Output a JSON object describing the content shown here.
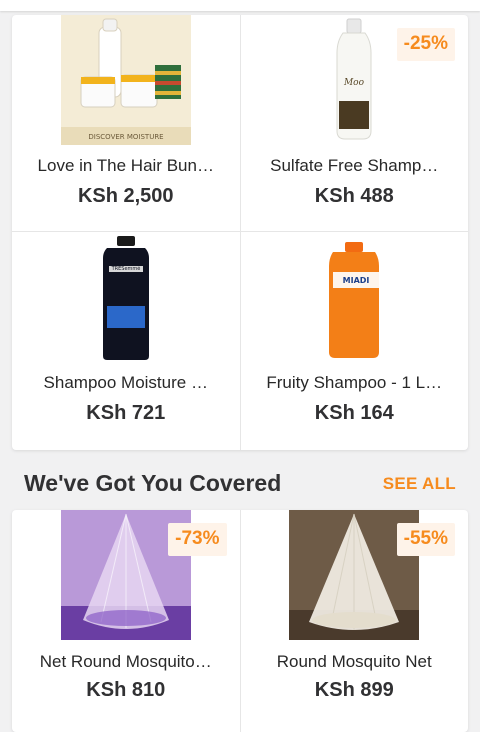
{
  "colors": {
    "accent": "#f68b1e",
    "badge_bg": "#fef3e9",
    "text": "#282828",
    "background": "#f1f1f2"
  },
  "products_top": [
    {
      "name": "Love in The Hair Bun…",
      "price": "KSh 2,500",
      "badge": ""
    },
    {
      "name": "Sulfate Free Shamp…",
      "price": "KSh 488",
      "badge": "-25%"
    },
    {
      "name": "Shampoo Moisture …",
      "price": "KSh 721",
      "badge": ""
    },
    {
      "name": "Fruity Shampoo - 1 L…",
      "price": "KSh 164",
      "badge": ""
    }
  ],
  "section": {
    "title": "We've Got You Covered",
    "see_all": "SEE ALL"
  },
  "products_bottom": [
    {
      "name": "Net Round Mosquito…",
      "price": "KSh 810",
      "badge": "-73%"
    },
    {
      "name": "Round Mosquito Net",
      "price": "KSh 899",
      "badge": "-55%"
    }
  ]
}
